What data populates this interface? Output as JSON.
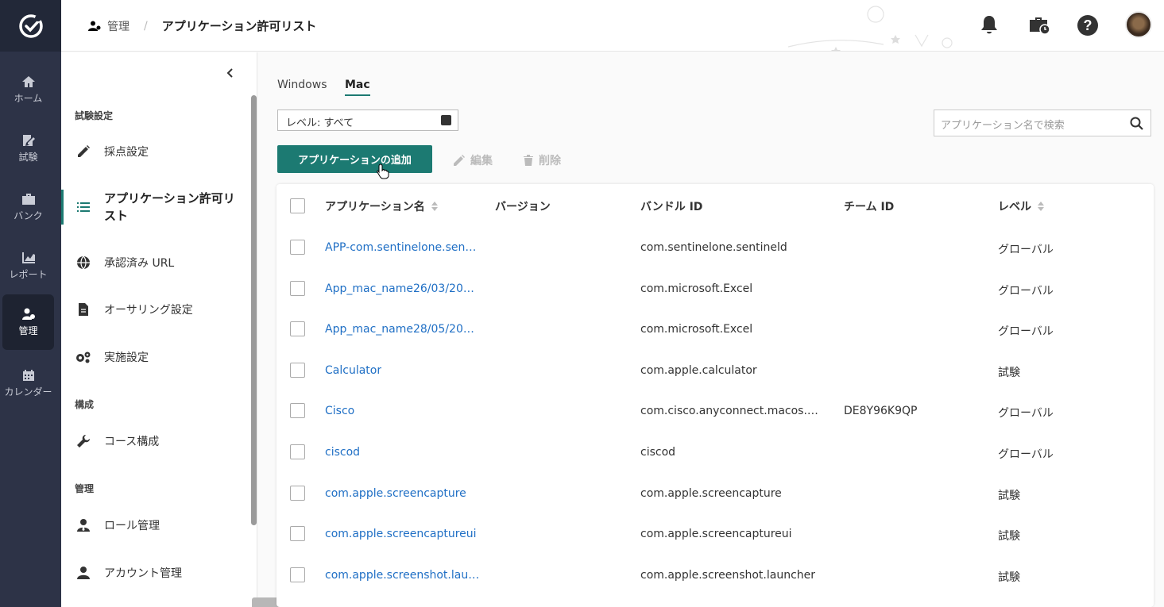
{
  "nav": {
    "items": [
      {
        "label": "ホーム",
        "icon": "home-icon"
      },
      {
        "label": "試験",
        "icon": "exam-icon"
      },
      {
        "label": "バンク",
        "icon": "bank-icon"
      },
      {
        "label": "レポート",
        "icon": "report-icon"
      },
      {
        "label": "管理",
        "icon": "admin-icon"
      },
      {
        "label": "カレンダー",
        "icon": "calendar-icon"
      }
    ]
  },
  "header": {
    "breadcrumb_parent": "管理",
    "breadcrumb_current": "アプリケーション許可リスト"
  },
  "sidebar": {
    "sections": [
      {
        "title": "試験設定"
      },
      {
        "title": "構成"
      },
      {
        "title": "管理"
      }
    ],
    "items": [
      {
        "label": "採点設定",
        "icon": "pencil-icon"
      },
      {
        "label": "アプリケーション許可リスト",
        "icon": "list-icon"
      },
      {
        "label": "承認済み URL",
        "icon": "globe-icon"
      },
      {
        "label": "オーサリング設定",
        "icon": "document-icon"
      },
      {
        "label": "実施設定",
        "icon": "gears-icon"
      },
      {
        "label": "コース構成",
        "icon": "wrench-icon"
      },
      {
        "label": "ロール管理",
        "icon": "user-tie-icon"
      },
      {
        "label": "アカウント管理",
        "icon": "user-icon"
      }
    ]
  },
  "tabs": [
    {
      "label": "Windows"
    },
    {
      "label": "Mac"
    }
  ],
  "filter": {
    "level_label": "レベル: すべて"
  },
  "search": {
    "placeholder": "アプリケーション名で検索"
  },
  "toolbar": {
    "add_label": "アプリケーションの追加",
    "edit_label": "編集",
    "delete_label": "削除"
  },
  "table": {
    "columns": [
      "アプリケーション名",
      "バージョン",
      "バンドル ID",
      "チーム ID",
      "レベル"
    ],
    "rows": [
      {
        "name": "APP-com.sentinelone.sent…",
        "version": "",
        "bundle": "com.sentinelone.sentineld",
        "team": "",
        "level": "グローバル"
      },
      {
        "name": "App_mac_name26/03/202…",
        "version": "",
        "bundle": "com.microsoft.Excel",
        "team": "",
        "level": "グローバル"
      },
      {
        "name": "App_mac_name28/05/202…",
        "version": "",
        "bundle": "com.microsoft.Excel",
        "team": "",
        "level": "グローバル"
      },
      {
        "name": "Calculator",
        "version": "",
        "bundle": "com.apple.calculator",
        "team": "",
        "level": "試験"
      },
      {
        "name": "Cisco",
        "version": "",
        "bundle": "com.cisco.anyconnect.macos.ac…",
        "team": "DE8Y96K9QP",
        "level": "グローバル"
      },
      {
        "name": "ciscod",
        "version": "",
        "bundle": "ciscod",
        "team": "",
        "level": "グローバル"
      },
      {
        "name": "com.apple.screencapture",
        "version": "",
        "bundle": "com.apple.screencapture",
        "team": "",
        "level": "試験"
      },
      {
        "name": "com.apple.screencaptureui",
        "version": "",
        "bundle": "com.apple.screencaptureui",
        "team": "",
        "level": "試験"
      },
      {
        "name": "com.apple.screenshot.laun…",
        "version": "",
        "bundle": "com.apple.screenshot.launcher",
        "team": "",
        "level": "試験"
      }
    ]
  },
  "colors": {
    "accent": "#1c7a72",
    "link": "#1f6fc5",
    "rail": "#2d3347"
  }
}
